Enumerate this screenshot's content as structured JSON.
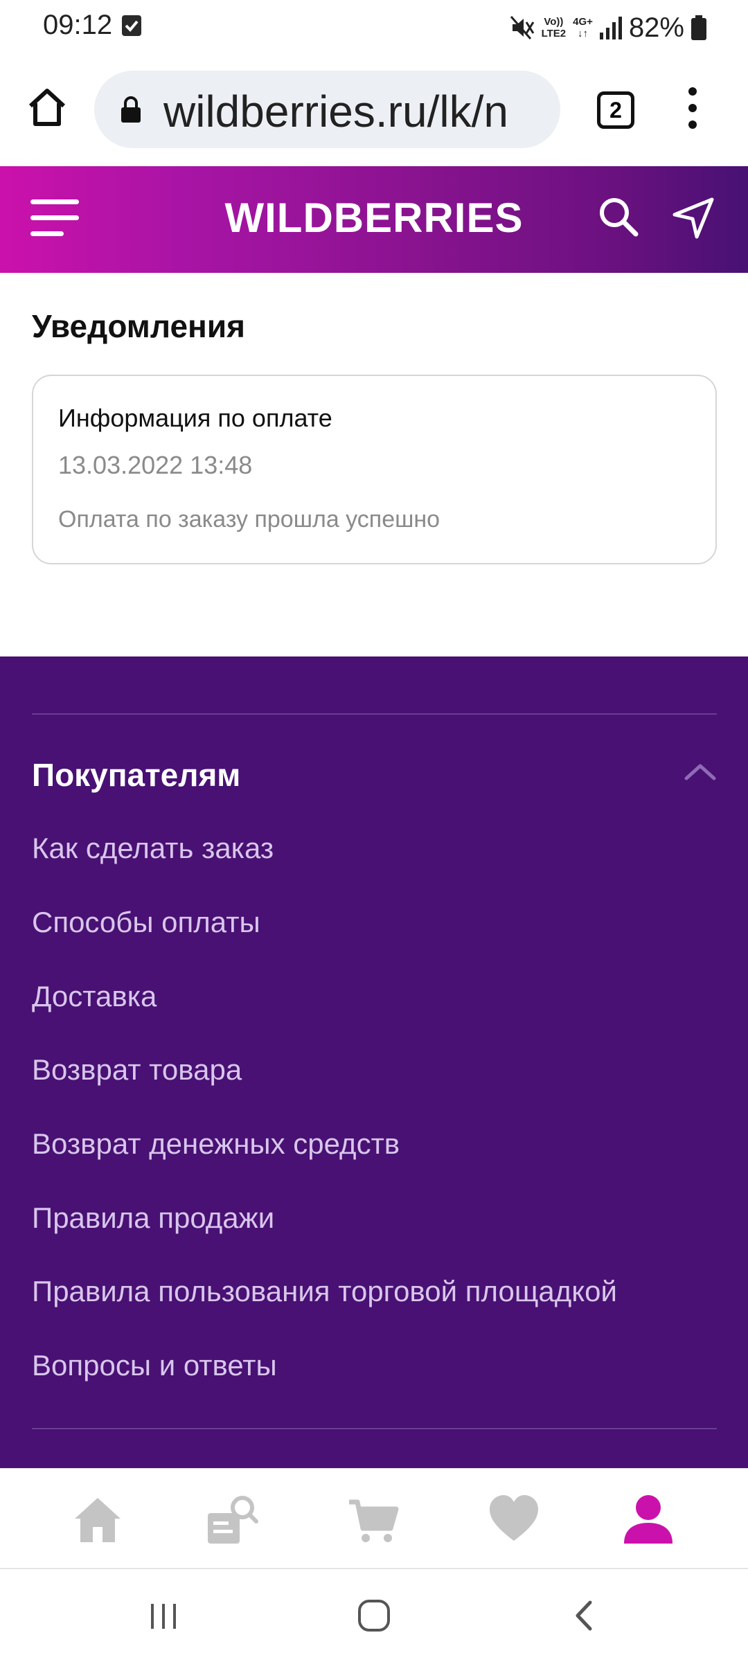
{
  "status_bar": {
    "time": "09:12",
    "lte_top": "Vo))",
    "lte_bottom": "LTE2",
    "net_top": "4G+",
    "battery": "82%"
  },
  "browser": {
    "url": "wildberries.ru/lk/n",
    "tab_count": "2"
  },
  "header": {
    "logo": "WILDBERRIES",
    "gradient_colors": [
      "#cb11ab",
      "#481173"
    ]
  },
  "notifications": {
    "title": "Уведомления",
    "items": [
      {
        "title": "Информация по оплате",
        "date": "13.03.2022 13:48",
        "text": "Оплата по заказу прошла успешно"
      }
    ]
  },
  "footer": {
    "heading": "Покупателям",
    "links": [
      "Как сделать заказ",
      "Способы оплаты",
      "Доставка",
      "Возврат товара",
      "Возврат денежных средств",
      "Правила продажи",
      "Правила пользования торговой площадкой",
      "Вопросы и ответы"
    ],
    "background": "#481173"
  },
  "bottom_nav": {
    "items": [
      "home-icon",
      "catalog-search-icon",
      "cart-icon",
      "heart-icon",
      "profile-icon"
    ],
    "active": "profile-icon",
    "active_color": "#cb11ab",
    "inactive_color": "#c4c4c4"
  },
  "system_nav": {
    "items": [
      "recent-apps-icon",
      "home-circle-icon",
      "back-icon"
    ]
  }
}
